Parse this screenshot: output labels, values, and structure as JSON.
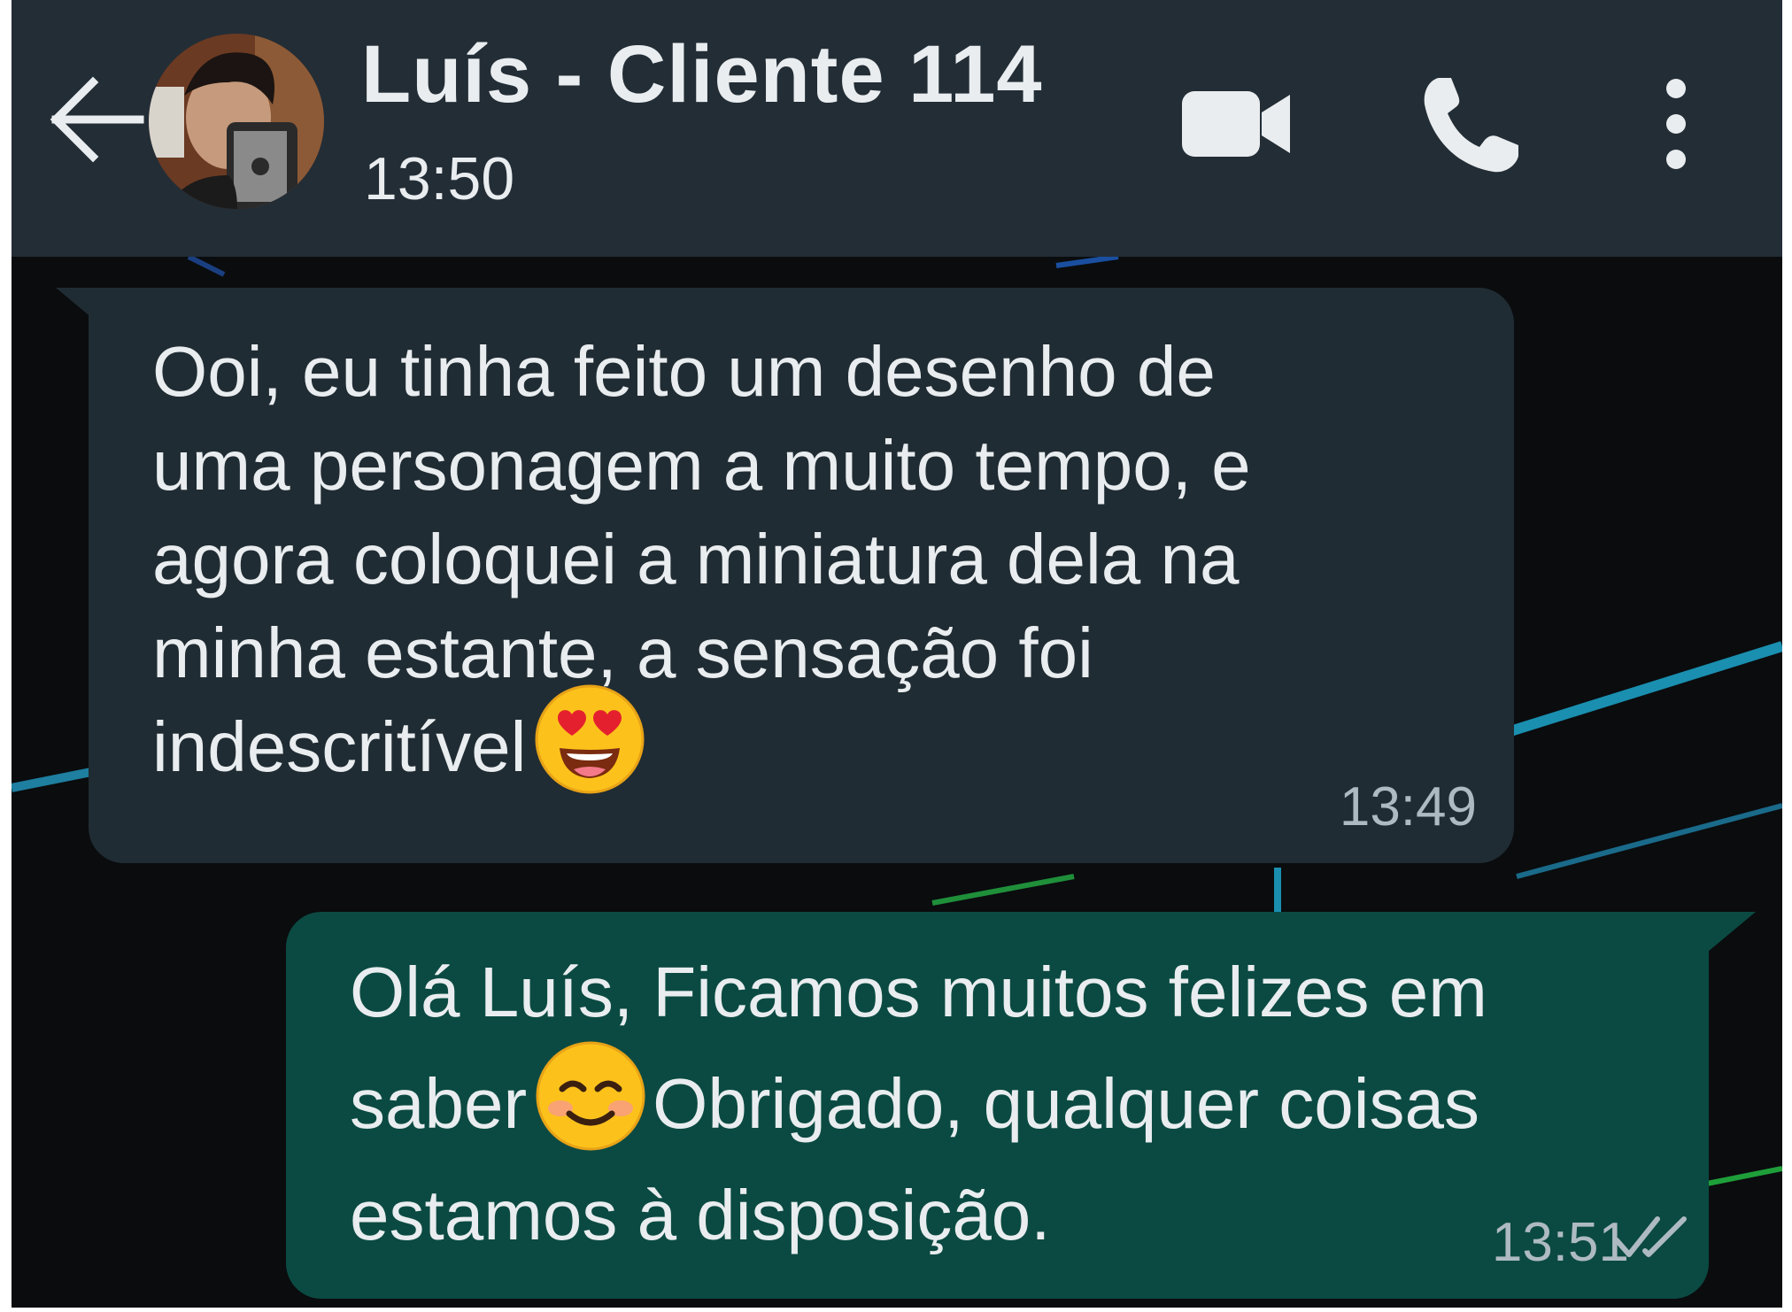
{
  "header": {
    "contact_name": "Luís - Cliente 114",
    "status": "13:50",
    "icons": [
      "back-arrow-icon",
      "avatar",
      "video-camera-icon",
      "phone-icon",
      "more-vertical-icon"
    ]
  },
  "messages": [
    {
      "direction": "incoming",
      "text_lines": [
        "Ooi, eu tinha feito um desenho de",
        "uma personagem a muito tempo, e",
        "agora coloquei a miniatura dela na",
        "minha estante, a sensação foi",
        "indescritível"
      ],
      "emoji": "heart-eyes-emoji",
      "time": "13:49"
    },
    {
      "direction": "outgoing",
      "text_line1": "Olá Luís, Ficamos muitos felizes em",
      "text_line2_before": "saber",
      "emoji": "smiling-face-emoji",
      "text_line2_after": "Obrigado, qualquer coisas",
      "text_line3": "estamos à disposição.",
      "time": "13:51",
      "status": "read-double-check-icon"
    }
  ],
  "colors": {
    "header_bg": "#232d36",
    "incoming_bubble": "#202c33",
    "outgoing_bubble": "#0b4a42",
    "text": "#e9edef",
    "meta_text": "#aebac1",
    "chat_bg": "#0a0c0e"
  }
}
